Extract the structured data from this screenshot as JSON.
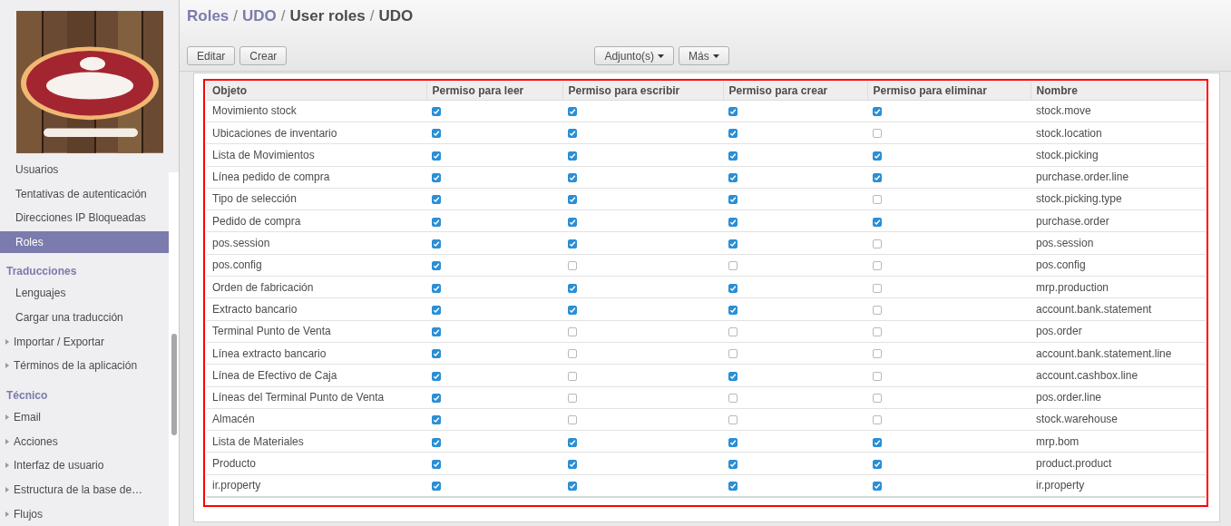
{
  "sidebar": {
    "sections": [
      {
        "items": [
          {
            "label": "Usuarios",
            "selected": false,
            "expandable": false
          },
          {
            "label": "Tentativas de autenticación",
            "selected": false,
            "expandable": false
          },
          {
            "label": "Direcciones IP Bloqueadas",
            "selected": false,
            "expandable": false
          },
          {
            "label": "Roles",
            "selected": true,
            "expandable": false
          }
        ]
      },
      {
        "title": "Traducciones",
        "items": [
          {
            "label": "Lenguajes",
            "selected": false,
            "expandable": false
          },
          {
            "label": "Cargar una traducción",
            "selected": false,
            "expandable": false
          },
          {
            "label": "Importar / Exportar",
            "selected": false,
            "expandable": true
          },
          {
            "label": "Términos de la aplicación",
            "selected": false,
            "expandable": true
          }
        ]
      },
      {
        "title": "Técnico",
        "items": [
          {
            "label": "Email",
            "selected": false,
            "expandable": true
          },
          {
            "label": "Acciones",
            "selected": false,
            "expandable": true
          },
          {
            "label": "Interfaz de usuario",
            "selected": false,
            "expandable": true
          },
          {
            "label": "Estructura de la base de…",
            "selected": false,
            "expandable": true
          },
          {
            "label": "Flujos",
            "selected": false,
            "expandable": true
          }
        ]
      }
    ]
  },
  "breadcrumb": {
    "separator": "/",
    "items": [
      {
        "label": "Roles",
        "link": true
      },
      {
        "label": "UDO",
        "link": true
      },
      {
        "label": "User roles",
        "link": false
      },
      {
        "label": "UDO",
        "link": false
      }
    ]
  },
  "buttons": [
    "Editar",
    "Crear"
  ],
  "dropdowns": [
    "Adjunto(s)",
    "Más"
  ],
  "table": {
    "columns": [
      "Objeto",
      "Permiso para leer",
      "Permiso para escribir",
      "Permiso para crear",
      "Permiso para eliminar",
      "Nombre"
    ],
    "rows": [
      {
        "object": "Movimiento stock",
        "read": true,
        "write": true,
        "create": true,
        "delete": true,
        "name": "stock.move"
      },
      {
        "object": "Ubicaciones de inventario",
        "read": true,
        "write": true,
        "create": true,
        "delete": false,
        "name": "stock.location"
      },
      {
        "object": "Lista de Movimientos",
        "read": true,
        "write": true,
        "create": true,
        "delete": true,
        "name": "stock.picking"
      },
      {
        "object": "Línea pedido de compra",
        "read": true,
        "write": true,
        "create": true,
        "delete": true,
        "name": "purchase.order.line"
      },
      {
        "object": "Tipo de selección",
        "read": true,
        "write": true,
        "create": true,
        "delete": false,
        "name": "stock.picking.type"
      },
      {
        "object": "Pedido de compra",
        "read": true,
        "write": true,
        "create": true,
        "delete": true,
        "name": "purchase.order"
      },
      {
        "object": "pos.session",
        "read": true,
        "write": true,
        "create": true,
        "delete": false,
        "name": "pos.session"
      },
      {
        "object": "pos.config",
        "read": true,
        "write": false,
        "create": false,
        "delete": false,
        "name": "pos.config"
      },
      {
        "object": "Orden de fabricación",
        "read": true,
        "write": true,
        "create": true,
        "delete": false,
        "name": "mrp.production"
      },
      {
        "object": "Extracto bancario",
        "read": true,
        "write": true,
        "create": true,
        "delete": false,
        "name": "account.bank.statement"
      },
      {
        "object": "Terminal Punto de Venta",
        "read": true,
        "write": false,
        "create": false,
        "delete": false,
        "name": "pos.order"
      },
      {
        "object": "Línea extracto bancario",
        "read": true,
        "write": false,
        "create": false,
        "delete": false,
        "name": "account.bank.statement.line"
      },
      {
        "object": "Línea de Efectivo de Caja",
        "read": true,
        "write": false,
        "create": true,
        "delete": false,
        "name": "account.cashbox.line"
      },
      {
        "object": "Líneas del Terminal Punto de Venta",
        "read": true,
        "write": false,
        "create": false,
        "delete": false,
        "name": "pos.order.line"
      },
      {
        "object": "Almacén",
        "read": true,
        "write": false,
        "create": false,
        "delete": false,
        "name": "stock.warehouse"
      },
      {
        "object": "Lista de Materiales",
        "read": true,
        "write": true,
        "create": true,
        "delete": true,
        "name": "mrp.bom"
      },
      {
        "object": "Producto",
        "read": true,
        "write": true,
        "create": true,
        "delete": true,
        "name": "product.product"
      },
      {
        "object": "ir.property",
        "read": true,
        "write": true,
        "create": true,
        "delete": true,
        "name": "ir.property"
      }
    ]
  }
}
